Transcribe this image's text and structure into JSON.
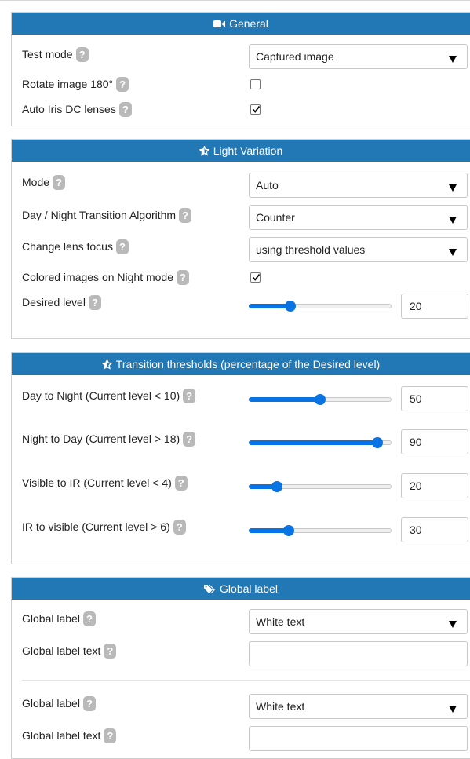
{
  "sections": {
    "general": {
      "title": "General",
      "test_mode": {
        "label": "Test mode",
        "value": "Captured image"
      },
      "rotate": {
        "label": "Rotate image 180°",
        "checked": false
      },
      "auto_iris": {
        "label": "Auto Iris DC lenses",
        "checked": true
      }
    },
    "light": {
      "title": "Light Variation",
      "mode": {
        "label": "Mode",
        "value": "Auto"
      },
      "algorithm": {
        "label": "Day / Night Transition Algorithm",
        "value": "Counter"
      },
      "focus": {
        "label": "Change lens focus",
        "value": "using threshold values"
      },
      "colored": {
        "label": "Colored images on Night mode",
        "checked": true
      },
      "desired": {
        "label": "Desired level",
        "value": "20",
        "slider_fraction": 0.29
      }
    },
    "thresholds": {
      "title": "Transition thresholds (percentage of the Desired level)",
      "rows": [
        {
          "label": "Day to Night (Current level < 10)",
          "value": "50",
          "slider_fraction": 0.5
        },
        {
          "label": "Night to Day (Current level > 18)",
          "value": "90",
          "slider_fraction": 0.9
        },
        {
          "label": "Visible to IR (Current level < 4)",
          "value": "20",
          "slider_fraction": 0.2
        },
        {
          "label": "IR to visible (Current level > 6)",
          "value": "30",
          "slider_fraction": 0.28
        }
      ]
    },
    "global": {
      "title": "Global label",
      "items": [
        {
          "label": "Global label",
          "value": "White text",
          "text_label": "Global label text",
          "text_value": ""
        },
        {
          "label": "Global label",
          "value": "White text",
          "text_label": "Global label text",
          "text_value": ""
        }
      ]
    }
  },
  "help_glyph": "?",
  "colors": {
    "header": "#2278b5",
    "accent": "#0a73e3",
    "help": "#b9b9b9"
  },
  "icons": {
    "general": "video-camera-icon",
    "light": "star-half-icon",
    "thresholds": "star-half-icon",
    "global": "tags-icon"
  }
}
